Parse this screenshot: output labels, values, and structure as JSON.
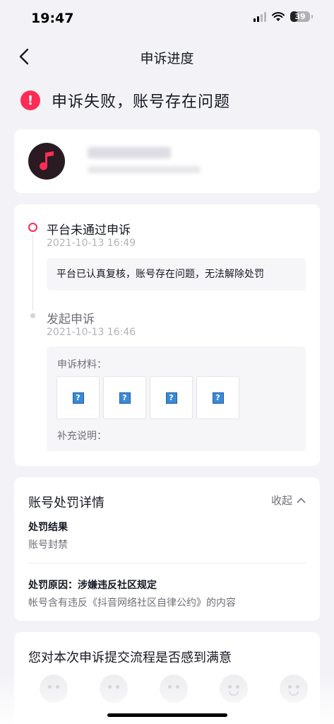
{
  "status_bar": {
    "time": "19:47",
    "battery": "39",
    "battery_level": 0.39
  },
  "nav": {
    "title": "申诉进度",
    "back_icon": "chevron-left-icon"
  },
  "result": {
    "icon_text": "!",
    "text": "申诉失败，账号存在问题",
    "color": "#fe2c55"
  },
  "timeline": {
    "steps": [
      {
        "title": "平台未通过申诉",
        "time": "2021-10-13 16:49",
        "message": "平台已认真复核，账号存在问题，无法解除处罚"
      },
      {
        "title": "发起申诉",
        "time": "2021-10-13 16:46"
      }
    ],
    "materials_label": "申诉材料：",
    "thumbs": [
      "?",
      "?",
      "?",
      "?"
    ],
    "supplement_label": "补充说明："
  },
  "penalty": {
    "title": "账号处罚详情",
    "collapse_label": "收起",
    "result_label": "处罚结果",
    "result_value": "账号封禁",
    "reason_label": "处罚原因：涉嫌违反社区规定",
    "reason_value": "帐号含有违反《抖音网络社区自律公约》的内容"
  },
  "survey": {
    "title": "您对本次申诉提交流程是否感到满意"
  }
}
